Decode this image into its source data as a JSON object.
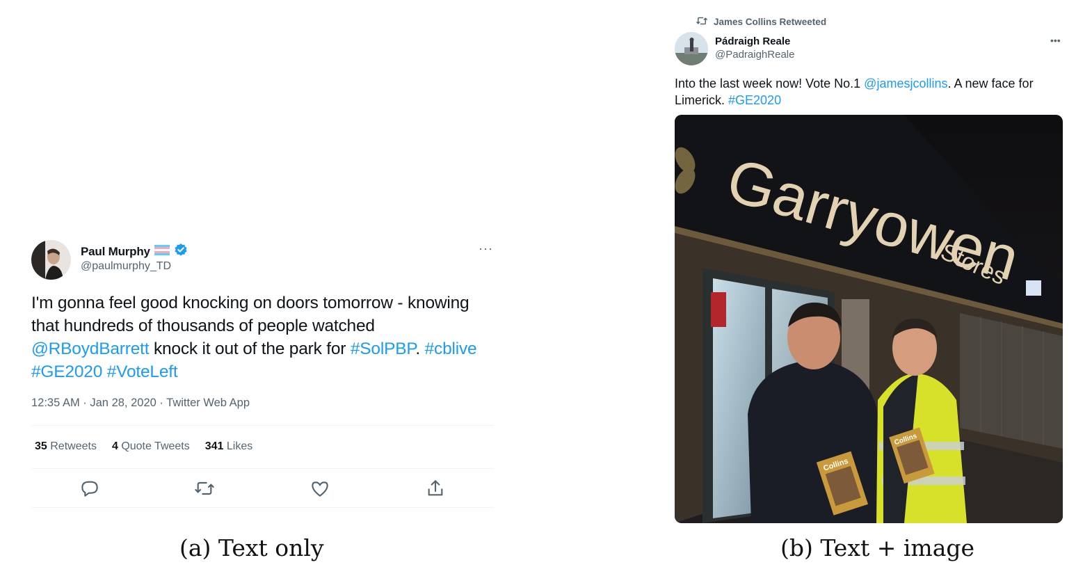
{
  "tweet_a": {
    "author_name": "Paul Murphy",
    "handle": "@paulmurphy_TD",
    "text_parts": [
      {
        "text": "I'm gonna feel good knocking on doors tomorrow - knowing that hundreds of thousands of people watched ",
        "link": false
      },
      {
        "text": "@RBoydBarrett",
        "link": true
      },
      {
        "text": " knock it out of the park for ",
        "link": false
      },
      {
        "text": "#SolPBP",
        "link": true
      },
      {
        "text": ". ",
        "link": false
      },
      {
        "text": "#cblive",
        "link": true
      },
      {
        "text": " ",
        "link": false
      },
      {
        "text": "#GE2020",
        "link": true
      },
      {
        "text": " ",
        "link": false
      },
      {
        "text": "#VoteLeft",
        "link": true
      }
    ],
    "meta": "12:35 AM · Jan 28, 2020 · Twitter Web App",
    "retweets_count": "35",
    "retweets_label": "Retweets",
    "quote_count": "4",
    "quote_label": "Quote Tweets",
    "likes_count": "341",
    "likes_label": "Likes",
    "more": "···",
    "icons": [
      "reply-icon",
      "retweet-icon",
      "like-icon",
      "share-icon"
    ]
  },
  "tweet_b": {
    "retweeted_by": "James Collins Retweeted",
    "author_name": "Pádraigh Reale",
    "handle": "@PadraighReale",
    "text_parts": [
      {
        "text": "Into the last week now! Vote No.1 ",
        "link": false
      },
      {
        "text": "@jamesjcollins",
        "link": true
      },
      {
        "text": ". A new face for Limerick. ",
        "link": false
      },
      {
        "text": "#GE2020",
        "link": true
      }
    ],
    "more": "•••",
    "photo": {
      "sign_text": "Garryowen Stores",
      "leaflet_text": "Collins"
    }
  },
  "captions": {
    "a": "(a) Text only",
    "b": "(b) Text + image"
  },
  "colors": {
    "link": "#1d9bf0",
    "secondary_text": "#536471",
    "verified": "#1d9bf0"
  }
}
